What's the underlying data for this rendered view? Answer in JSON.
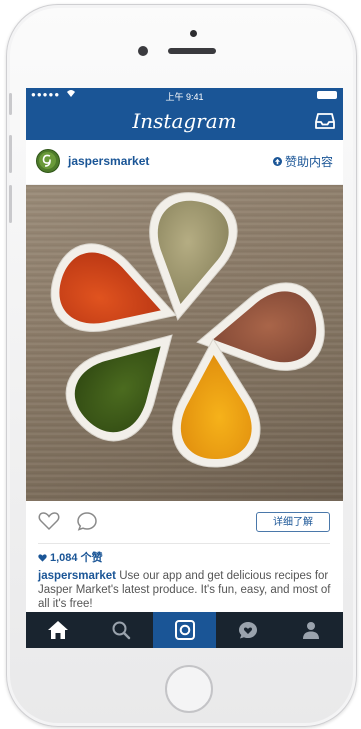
{
  "status_bar": {
    "signal": "●●●●●",
    "time": "上午 9:41"
  },
  "app": {
    "title": "Instagram"
  },
  "post": {
    "username": "jaspersmarket",
    "sponsored_label": "赞助内容",
    "learn_more_label": "详细了解",
    "likes_text": "1,084 个赞",
    "caption_username": "jaspersmarket",
    "caption_text": " Use our app and get delicious recipes for Jasper Market's latest produce. It's fun, easy, and most of all it's free!"
  },
  "tabs": [
    {
      "icon": "home-icon"
    },
    {
      "icon": "search-icon"
    },
    {
      "icon": "camera-icon",
      "active": true
    },
    {
      "icon": "activity-icon"
    },
    {
      "icon": "profile-icon"
    }
  ],
  "colors": {
    "brand_blue": "#1a5596",
    "tabbar": "#19242f"
  }
}
